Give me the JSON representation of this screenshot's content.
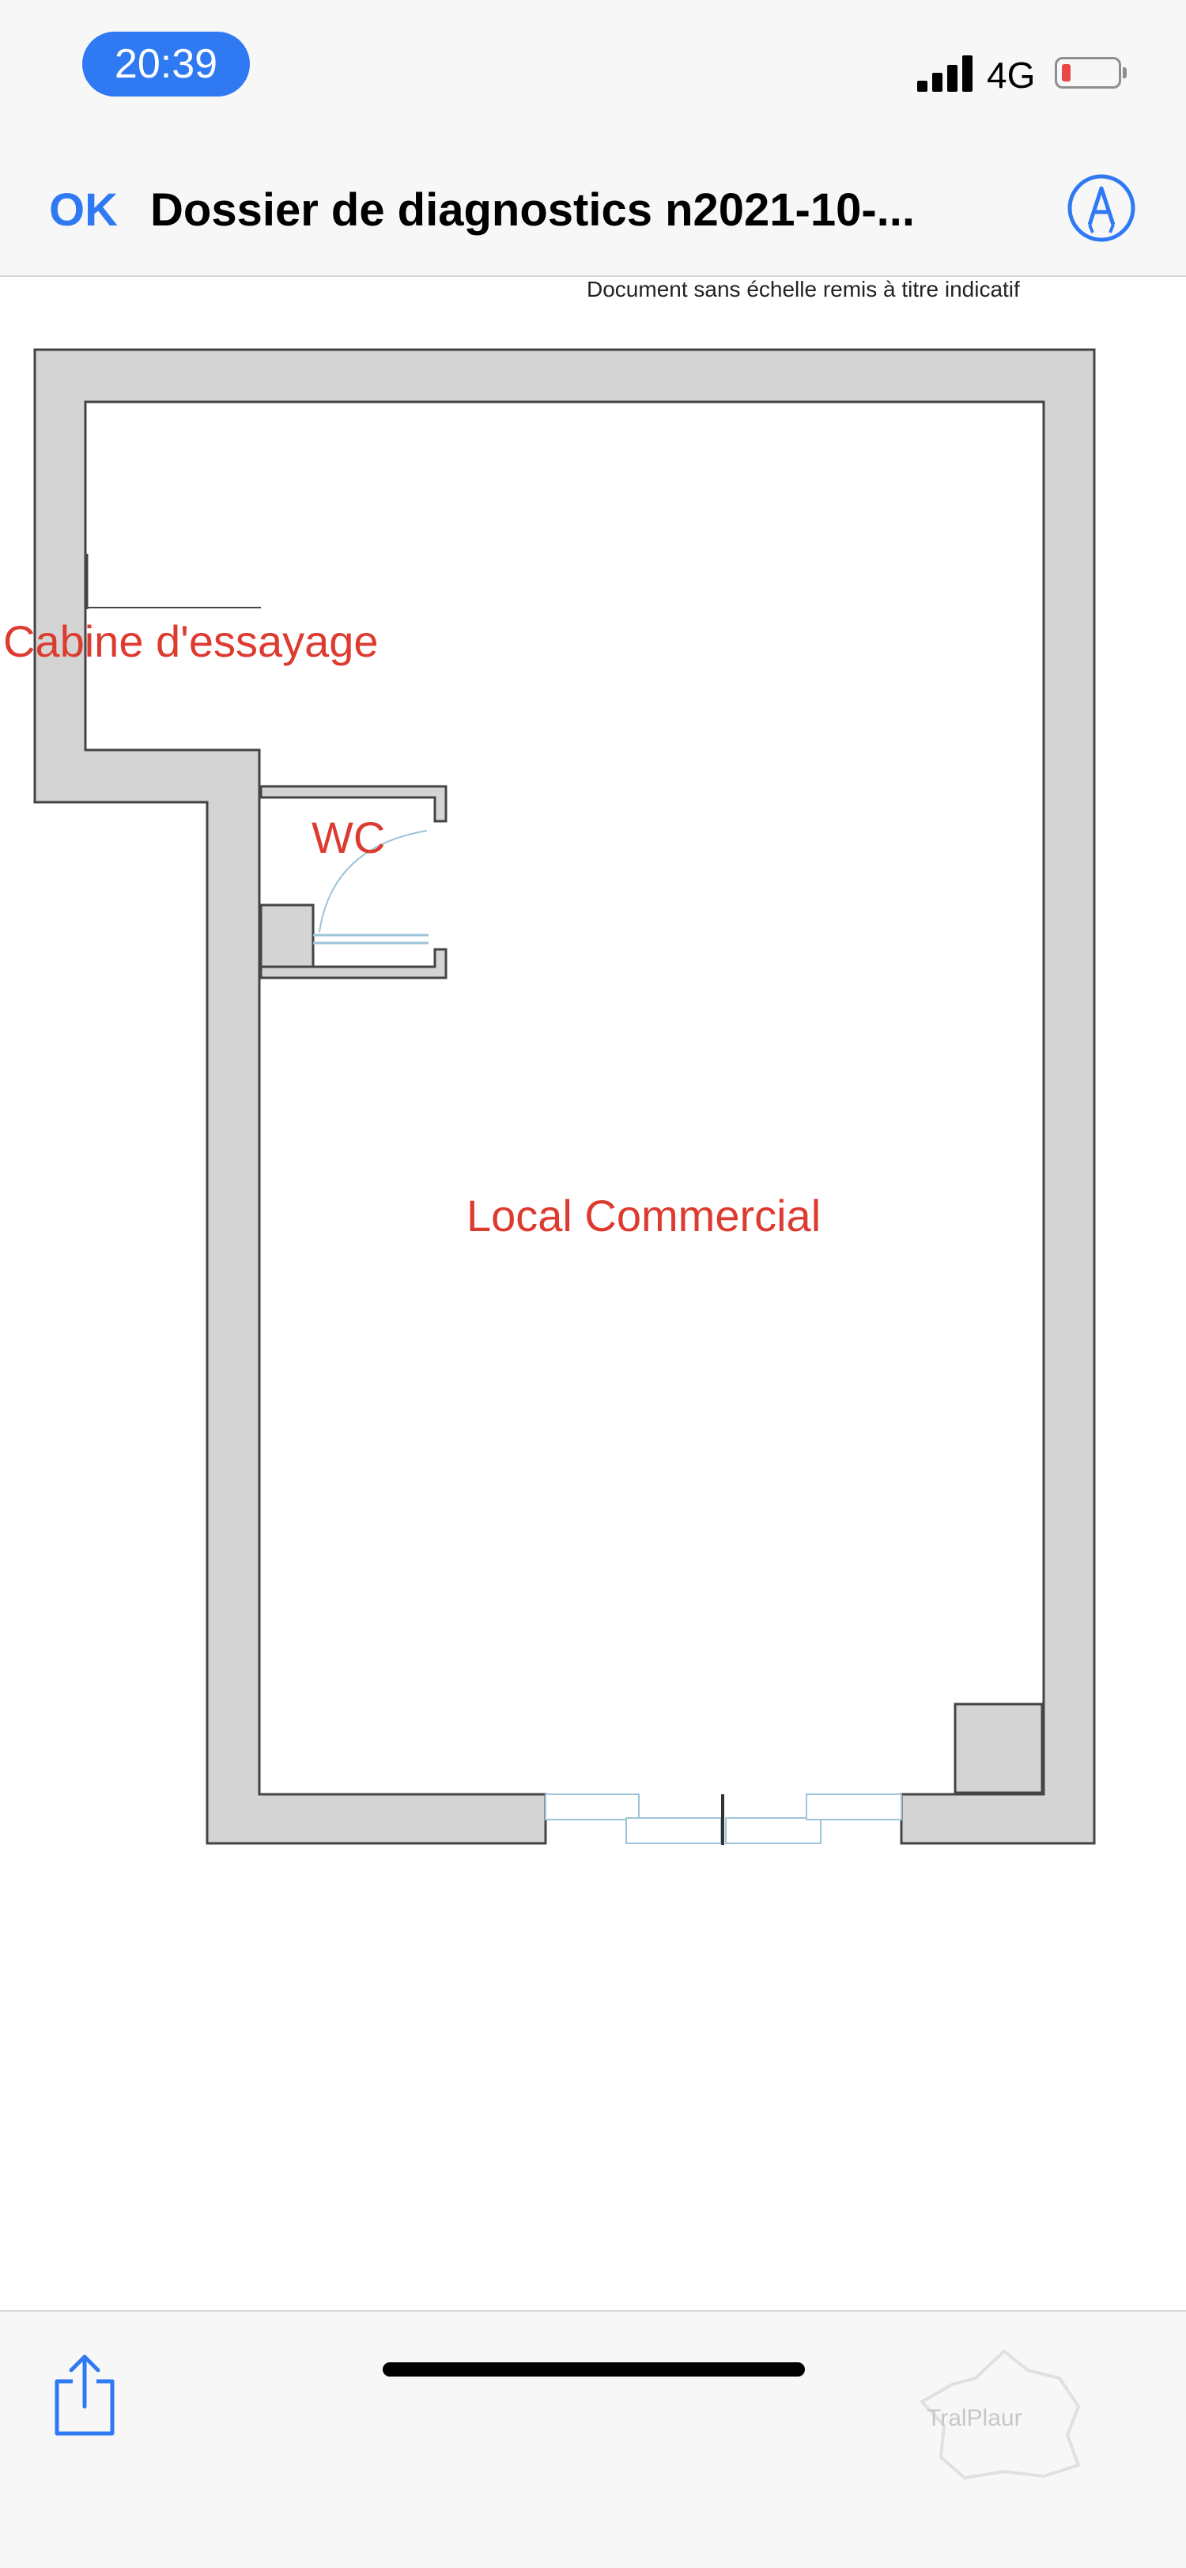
{
  "status_bar": {
    "time": "20:39",
    "network": "4G",
    "battery_color": "#e94848",
    "signal_icon": "cellular-signal-icon"
  },
  "nav_bar": {
    "ok_label": "OK",
    "title": "Dossier de diagnostics n2021-10-...",
    "markup_icon": "markup-pen-icon",
    "accent_color": "#2f7af3"
  },
  "document": {
    "disclaimer": "Document sans échelle remis à titre indicatif",
    "rooms": {
      "cabine": "Cabine d'essayage",
      "wc": "WC",
      "local": "Local Commercial"
    },
    "label_color": "#dd3a30",
    "wall_color": "#d4d4d4"
  },
  "toolbar": {
    "share_icon": "share-icon",
    "watermark_icon": "france-map-watermark-icon",
    "watermark_text": "TralPlaur"
  }
}
